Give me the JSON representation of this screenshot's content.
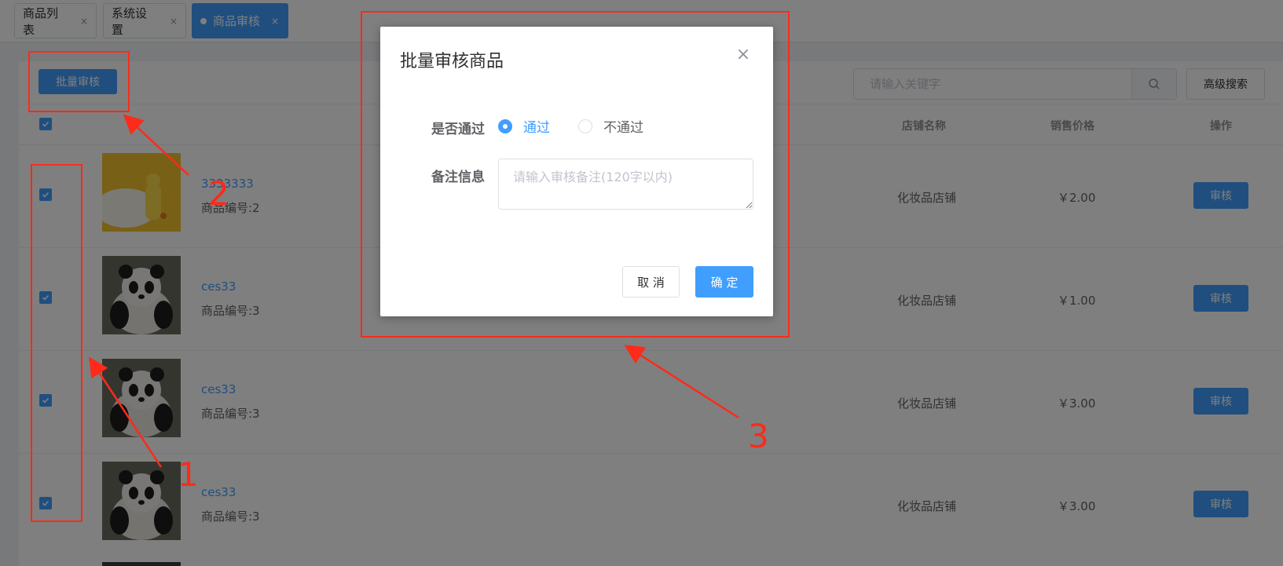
{
  "tabs": [
    {
      "label": "商品列表",
      "close": "×"
    },
    {
      "label": "系统设置",
      "close": "×"
    },
    {
      "label": "商品审核",
      "close": "×"
    }
  ],
  "toolbar": {
    "batch_review_label": "批量审核",
    "search_placeholder": "请输入关键字",
    "advanced_search_label": "高级搜索"
  },
  "table": {
    "headers": {
      "store": "店铺名称",
      "price": "销售价格",
      "action": "操作"
    },
    "rows": [
      {
        "name": "3333333",
        "code": "商品编号:2",
        "store": "化妆品店铺",
        "price": "￥2.00",
        "action": "审核"
      },
      {
        "name": "ces33",
        "code": "商品编号:3",
        "store": "化妆品店铺",
        "price": "￥1.00",
        "action": "审核"
      },
      {
        "name": "ces33",
        "code": "商品编号:3",
        "store": "化妆品店铺",
        "price": "￥3.00",
        "action": "审核"
      },
      {
        "name": "ces33",
        "code": "商品编号:3",
        "store": "化妆品店铺",
        "price": "￥3.00",
        "action": "审核"
      }
    ]
  },
  "dialog": {
    "title": "批量审核商品",
    "close": "×",
    "pass_label": "是否通过",
    "option_pass": "通过",
    "option_fail": "不通过",
    "selected": "通过",
    "remark_label": "备注信息",
    "remark_placeholder": "请输入审核备注(120字以内)",
    "cancel_label": "取 消",
    "confirm_label": "确 定"
  },
  "annotations": [
    "1",
    "2",
    "3"
  ],
  "colors": {
    "primary": "#409eff",
    "annotation": "#ff2a1a"
  }
}
